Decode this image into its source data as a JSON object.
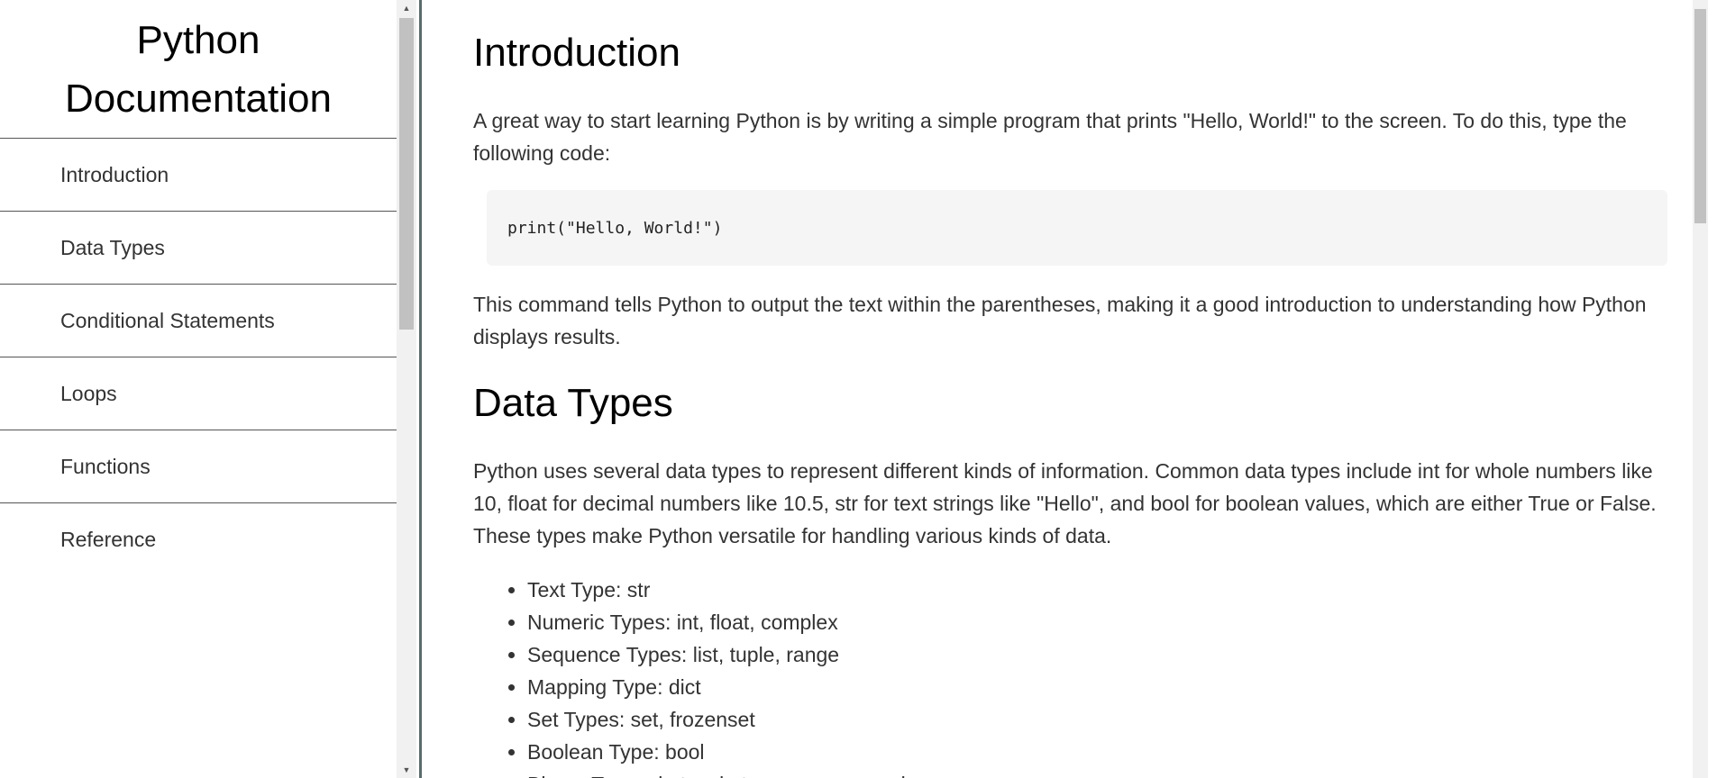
{
  "sidebar": {
    "title_line1": "Python",
    "title_line2": "Documentation",
    "items": [
      {
        "label": "Introduction"
      },
      {
        "label": "Data Types"
      },
      {
        "label": "Conditional Statements"
      },
      {
        "label": "Loops"
      },
      {
        "label": "Functions"
      },
      {
        "label": "Reference"
      }
    ]
  },
  "main": {
    "introduction": {
      "title": "Introduction",
      "paragraph1": "A great way to start learning Python is by writing a simple program that prints \"Hello, World!\" to the screen. To do this, type the following code:",
      "code": "print(\"Hello, World!\")",
      "paragraph2": "This command tells Python to output the text within the parentheses, making it a good introduction to understanding how Python displays results."
    },
    "data_types": {
      "title": "Data Types",
      "paragraph1": "Python uses several data types to represent different kinds of information. Common data types include int for whole numbers like 10, float for decimal numbers like 10.5, str for text strings like \"Hello\", and bool for boolean values, which are either True or False. These types make Python versatile for handling various kinds of data.",
      "list": [
        "Text Type: str",
        "Numeric Types: int, float, complex",
        "Sequence Types: list, tuple, range",
        "Mapping Type: dict",
        "Set Types: set, frozenset",
        "Boolean Type: bool",
        "Binary Types: bytes, bytearray, memoryview"
      ]
    }
  }
}
